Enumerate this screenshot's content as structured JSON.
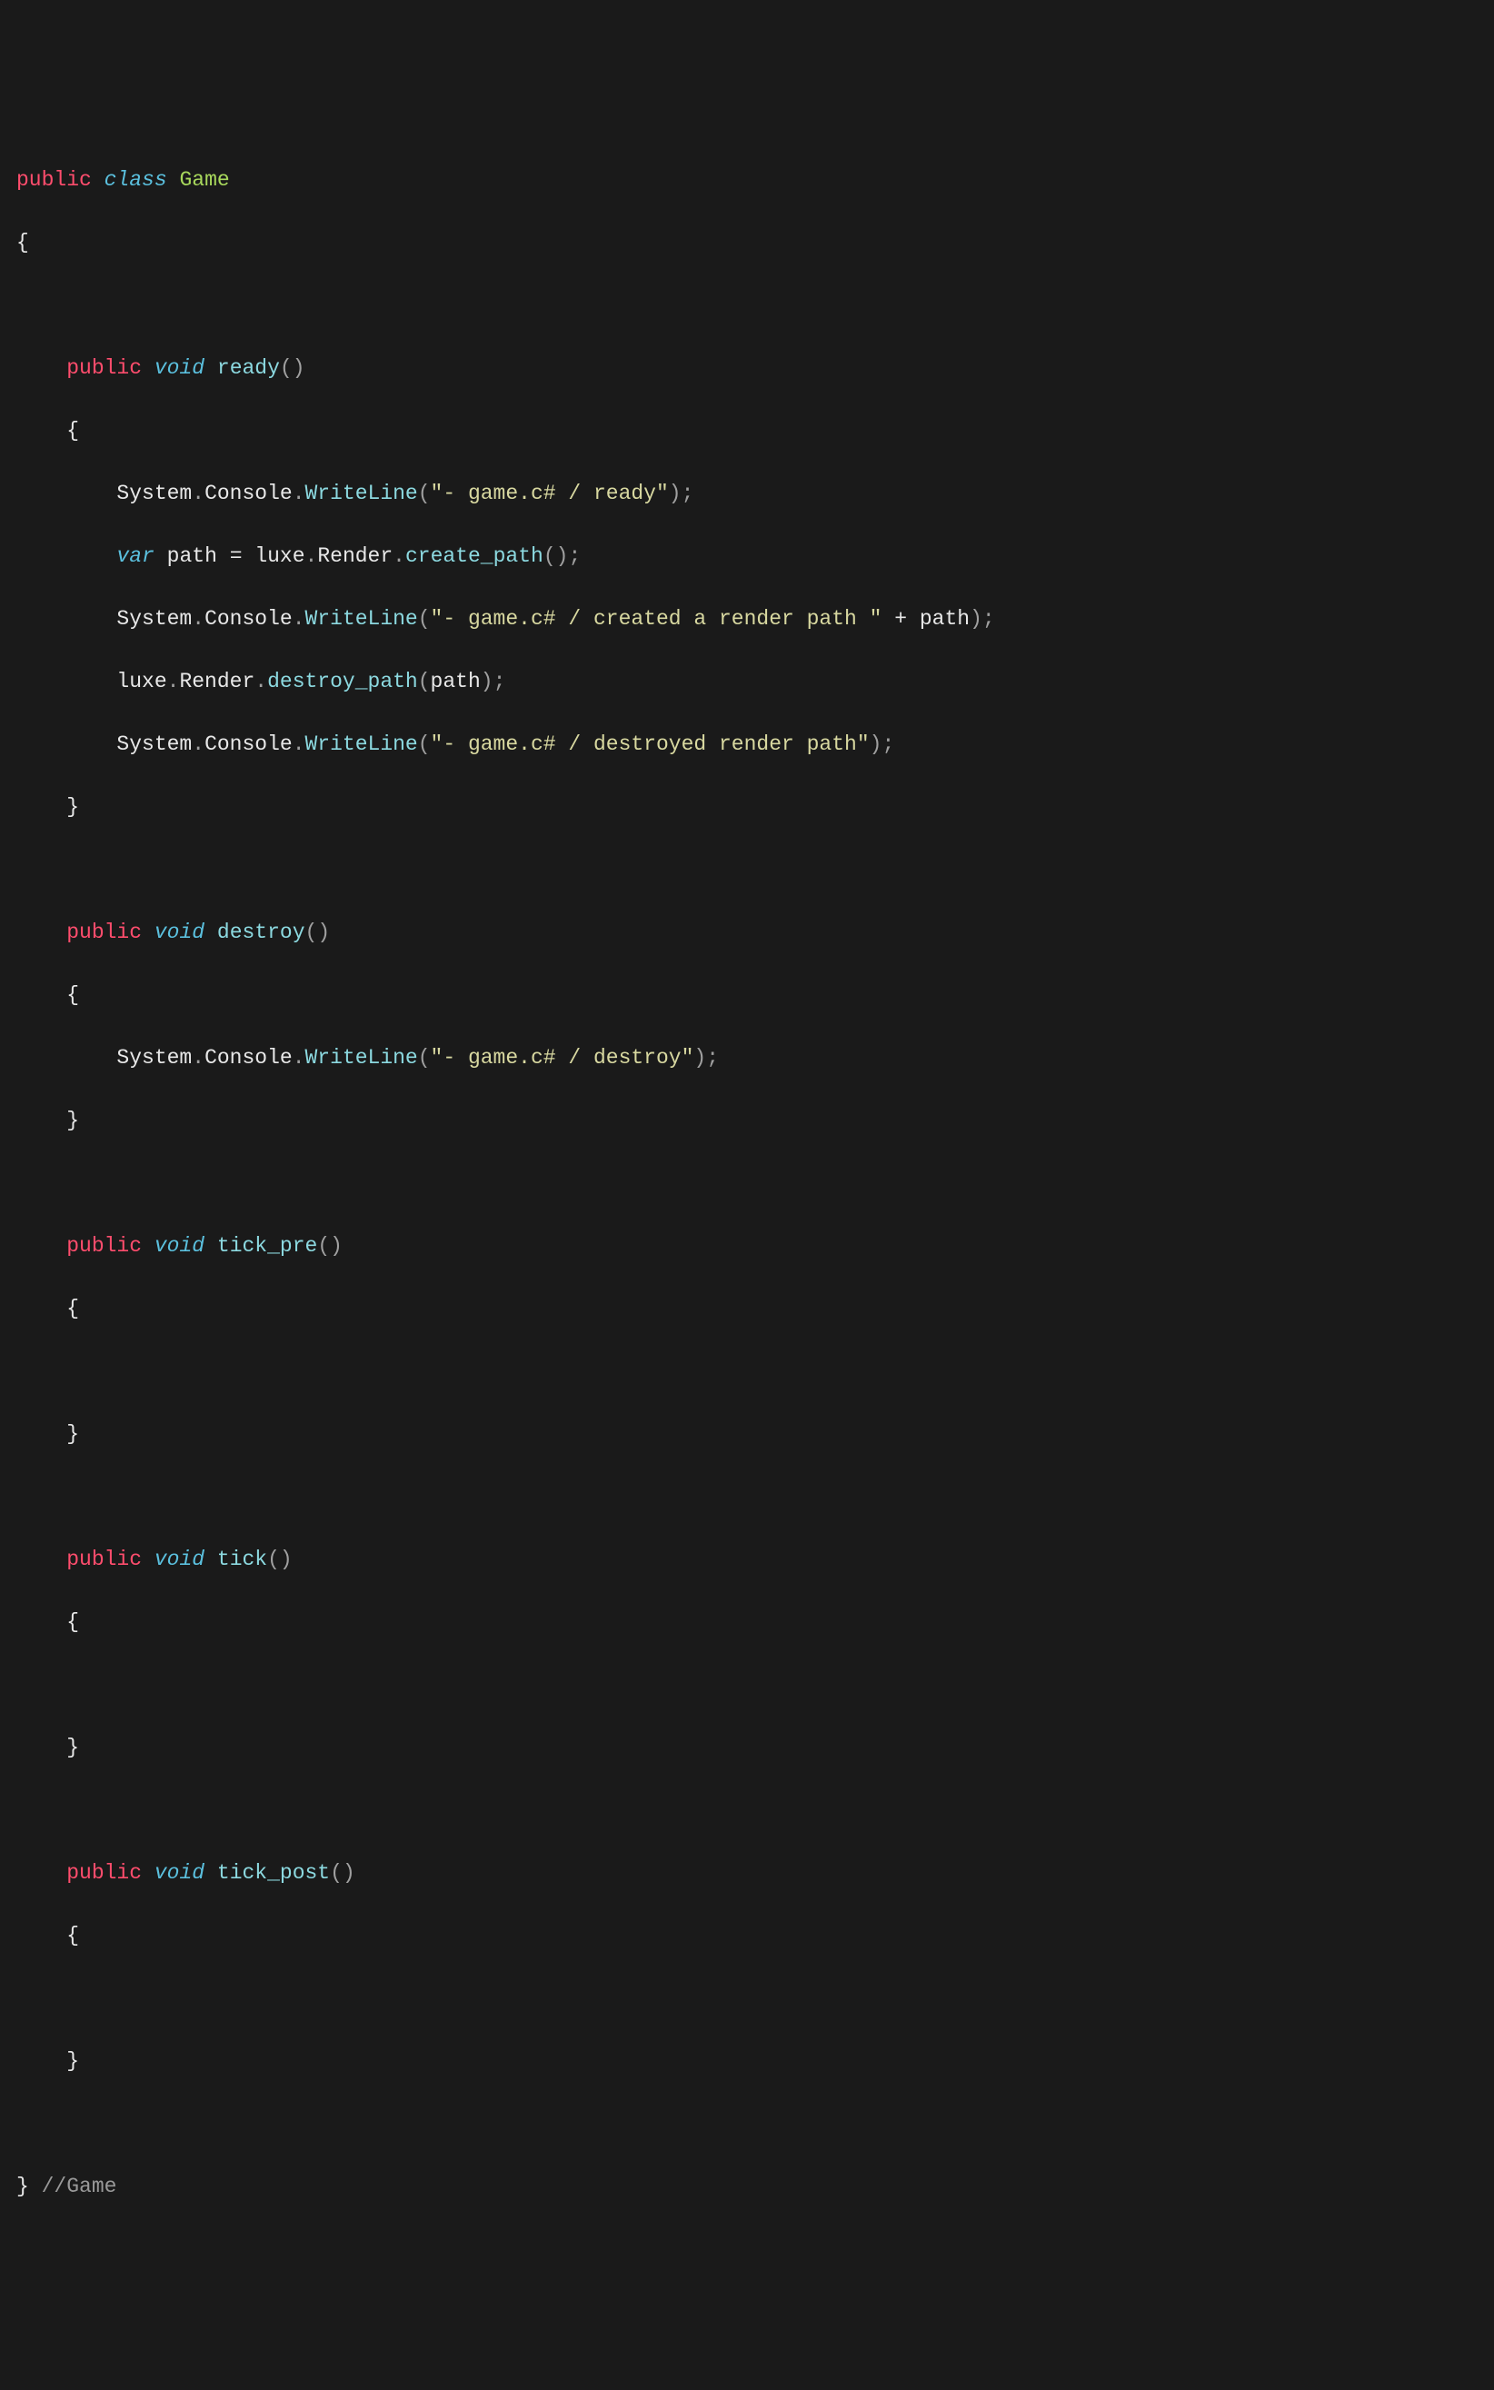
{
  "colors": {
    "background": "#1a1a1a",
    "keyword_pink": "#ff4d6d",
    "keyword_cyan": "#5bc0de",
    "class_green": "#a8d85c",
    "method_teal": "#8cd9e0",
    "string_yellow": "#d8d8a0",
    "comment_gray": "#999999",
    "text": "#e8e8e8",
    "punct": "#a0a0a0"
  },
  "tokens": {
    "kw_public": "public",
    "kw_class": "class",
    "kw_void": "void",
    "kw_var": "var",
    "cls_Game": "Game",
    "m_ready": "ready",
    "m_destroy": "destroy",
    "m_tick_pre": "tick_pre",
    "m_tick": "tick",
    "m_tick_post": "tick_post",
    "t_System": "System",
    "t_Console": "Console",
    "t_WriteLine": "WriteLine",
    "t_luxe": "luxe",
    "t_Render": "Render",
    "t_create_path": "create_path",
    "t_destroy_path": "destroy_path",
    "v_path": "path",
    "op_eq": "=",
    "op_plus": "+",
    "lbrace": "{",
    "rbrace": "}",
    "lparen": "(",
    "rparen": ")",
    "semi": ";",
    "dot": ".",
    "s_ready": "\"- game.c# / ready\"",
    "s_created": "\"- game.c# / created a render path \"",
    "s_destroyed": "\"- game.c# / destroyed render path\"",
    "s_destroy": "\"- game.c# / destroy\"",
    "cmt_game": "//Game"
  }
}
